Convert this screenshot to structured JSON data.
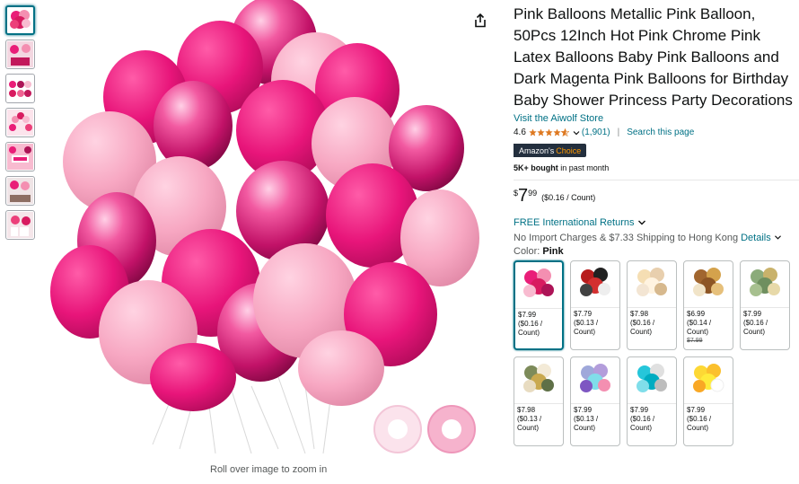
{
  "gallery": {
    "thumbnails": [
      {
        "name": "thumb-pink-bunch"
      },
      {
        "name": "thumb-party-scene"
      },
      {
        "name": "thumb-balloon-sizes"
      },
      {
        "name": "thumb-arch-decoration"
      },
      {
        "name": "thumb-bride-sign"
      },
      {
        "name": "thumb-table-decor"
      },
      {
        "name": "thumb-birthday-16"
      }
    ],
    "zoom_hint": "Roll over image to zoom in"
  },
  "product": {
    "title": "Pink Balloons Metallic Pink Balloon, 50Pcs 12Inch Hot Pink Chrome Pink Latex Balloons Baby Pink Balloons and Dark Magenta Pink Balloons for Birthday Baby Shower Princess Party Decorations",
    "store_link": "Visit the Aiwolf Store",
    "rating": "4.6",
    "review_count": "(1,901)",
    "search_page": "Search this page",
    "badge_prefix": "Amazon's",
    "badge_choice": "Choice",
    "bought_bold": "5K+ bought",
    "bought_rest": "in past month",
    "price_currency": "$",
    "price_whole": "7",
    "price_fraction": "99",
    "price_unit": "($0.16 / Count)",
    "returns": "FREE International Returns",
    "shipping": "No Import Charges & $7.33 Shipping to Hong Kong",
    "details": "Details",
    "color_label": "Color:",
    "color_value": "Pink"
  },
  "swatches": [
    {
      "price": "$7.99",
      "unit1": "($0.16 /",
      "unit2": "Count)",
      "strike": ""
    },
    {
      "price": "$7.79",
      "unit1": "($0.13 /",
      "unit2": "Count)",
      "strike": ""
    },
    {
      "price": "$7.98",
      "unit1": "($0.16 /",
      "unit2": "Count)",
      "strike": ""
    },
    {
      "price": "$6.99",
      "unit1": "($0.14 /",
      "unit2": "Count)",
      "strike": "$7.99"
    },
    {
      "price": "$7.99",
      "unit1": "($0.16 /",
      "unit2": "Count)",
      "strike": ""
    },
    {
      "price": "$7.98",
      "unit1": "($0.13 /",
      "unit2": "Count)",
      "strike": ""
    },
    {
      "price": "$7.99",
      "unit1": "($0.13 /",
      "unit2": "Count)",
      "strike": ""
    },
    {
      "price": "$7.99",
      "unit1": "($0.16 /",
      "unit2": "Count)",
      "strike": ""
    },
    {
      "price": "$7.99",
      "unit1": "($0.16 /",
      "unit2": "Count)",
      "strike": ""
    }
  ],
  "colors": {
    "link": "#007185",
    "badge_bg": "#232f3e",
    "badge_accent": "#ff9900",
    "star": "#de7921"
  }
}
